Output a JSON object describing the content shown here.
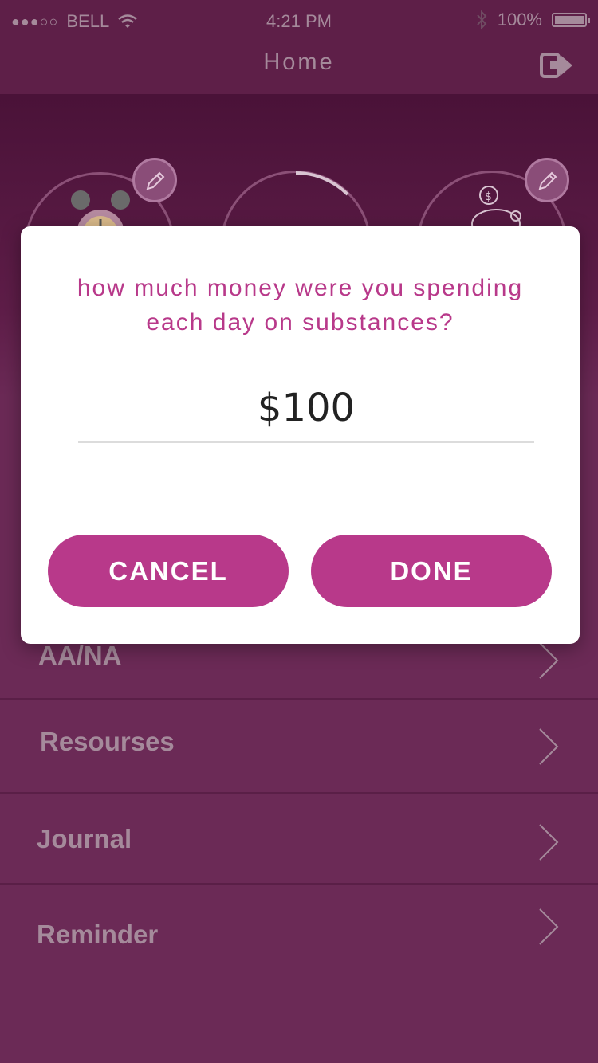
{
  "status_bar": {
    "signal": "●●●○○",
    "carrier": "BELL",
    "time": "4:21 PM",
    "battery": "100%"
  },
  "nav": {
    "title": "Home"
  },
  "dialog": {
    "question": "how much money were you spending each day on substances?",
    "amount": "$100",
    "cancel_label": "CANCEL",
    "done_label": "DONE"
  },
  "menu": [
    {
      "label": "AA/NA"
    },
    {
      "label": "Resourses"
    },
    {
      "label": "Journal"
    },
    {
      "label": "Reminder"
    }
  ],
  "colors": {
    "accent": "#b8398a",
    "background": "#6b2a56",
    "header": "#5e1f48"
  }
}
